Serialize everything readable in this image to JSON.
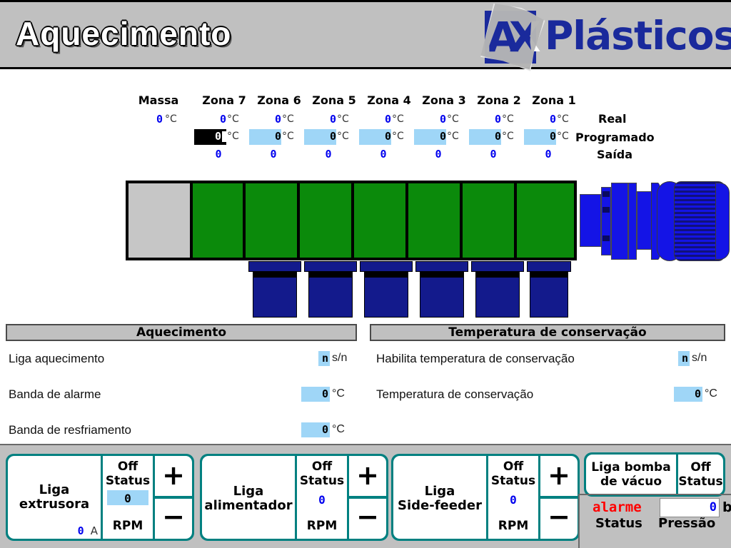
{
  "header": {
    "title": "Aquecimento",
    "logo_letters": [
      "A",
      "X"
    ],
    "logo_text": "Plásticos",
    "brand_color": "#1a2a9c"
  },
  "zones": {
    "columns": [
      {
        "name": "Massa",
        "real": "0",
        "unit": "°C",
        "programado": null,
        "saida": null,
        "selected": false
      },
      {
        "name": "Zona 7",
        "real": "0",
        "unit": "°C",
        "programado": "0",
        "saida": "0",
        "selected": true
      },
      {
        "name": "Zona 6",
        "real": "0",
        "unit": "°C",
        "programado": "0",
        "saida": "0",
        "selected": false
      },
      {
        "name": "Zona 5",
        "real": "0",
        "unit": "°C",
        "programado": "0",
        "saida": "0",
        "selected": false
      },
      {
        "name": "Zona 4",
        "real": "0",
        "unit": "°C",
        "programado": "0",
        "saida": "0",
        "selected": false
      },
      {
        "name": "Zona 3",
        "real": "0",
        "unit": "°C",
        "programado": "0",
        "saida": "0",
        "selected": false
      },
      {
        "name": "Zona 2",
        "real": "0",
        "unit": "°C",
        "programado": "0",
        "saida": "0",
        "selected": false
      },
      {
        "name": "Zona 1",
        "real": "0",
        "unit": "°C",
        "programado": "0",
        "saida": "0",
        "selected": false
      }
    ],
    "row_labels": {
      "real": "Real",
      "programado": "Programado",
      "saida": "Saída"
    },
    "colors": {
      "value_blue": "#0000ee",
      "field_blue": "#9fd6f7",
      "selected_bg": "#000000"
    }
  },
  "diagram": {
    "hopper_color": "#c6c6c6",
    "barrel_color": "#0b8a0b",
    "heater_color": "#131a8c",
    "motor_color": "#1414e6",
    "heater_count": 6,
    "barrel_segments": 7
  },
  "panel_heating": {
    "title": "Aquecimento",
    "rows": [
      {
        "label": "Liga aquecimento",
        "value": "n",
        "unit": "s/n",
        "field": "narrow"
      },
      {
        "label": "Banda de alarme",
        "value": "0",
        "unit": "°C",
        "field": "wide"
      },
      {
        "label": "Banda de resfriamento",
        "value": "0",
        "unit": "°C",
        "field": "wide"
      }
    ]
  },
  "panel_conservation": {
    "title": "Temperatura de conservação",
    "rows": [
      {
        "label": "Habilita temperatura de conservação",
        "value": "n",
        "unit": "s/n",
        "field": "narrow"
      },
      {
        "label": "Temperatura de conservação",
        "value": "0",
        "unit": "°C",
        "field": "wide"
      }
    ]
  },
  "controls": [
    {
      "name_line1": "Liga",
      "name_line2": "extrusora",
      "current": "0",
      "current_unit": "A",
      "status_value": "Off",
      "status_label": "Status",
      "rpm_value": "0",
      "rpm_label": "RPM",
      "rpm_boxed": true,
      "plus": "+",
      "minus": "−"
    },
    {
      "name_line1": "Liga",
      "name_line2": "alimentador",
      "current": null,
      "current_unit": null,
      "status_value": "Off",
      "status_label": "Status",
      "rpm_value": "0",
      "rpm_label": "RPM",
      "rpm_boxed": false,
      "plus": "+",
      "minus": "−"
    },
    {
      "name_line1": "Liga",
      "name_line2": "Side-feeder",
      "current": null,
      "current_unit": null,
      "status_value": "Off",
      "status_label": "Status",
      "rpm_value": "0",
      "rpm_label": "RPM",
      "rpm_boxed": false,
      "plus": "+",
      "minus": "−"
    }
  ],
  "vacuum": {
    "name_line1": "Liga bomba",
    "name_line2": "de vácuo",
    "status_value": "Off",
    "status_label": "Status"
  },
  "alarm": {
    "state": "alarme",
    "state_color": "#ff0000",
    "status_label": "Status",
    "pressure_value": "0",
    "pressure_unit": "bar",
    "pressure_label": "Pressão"
  }
}
